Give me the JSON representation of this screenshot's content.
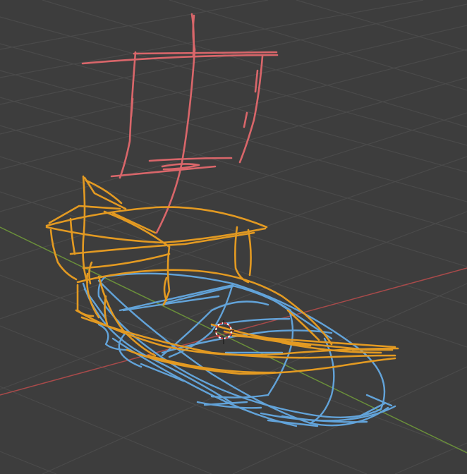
{
  "viewport": {
    "mode": "3d-viewport",
    "background": "#3d3d3d",
    "grid_color": "#4a4a4a",
    "x_axis_color": "#a84a4a",
    "y_axis_color": "#6a8f3a"
  },
  "scene": {
    "objects": [
      {
        "name": "sail",
        "color": "#d9666a"
      },
      {
        "name": "hull-upper",
        "color": "#e39a22"
      },
      {
        "name": "hull-lower",
        "color": "#62a3d9"
      }
    ],
    "cursor_icon": "3d-cursor-icon"
  }
}
